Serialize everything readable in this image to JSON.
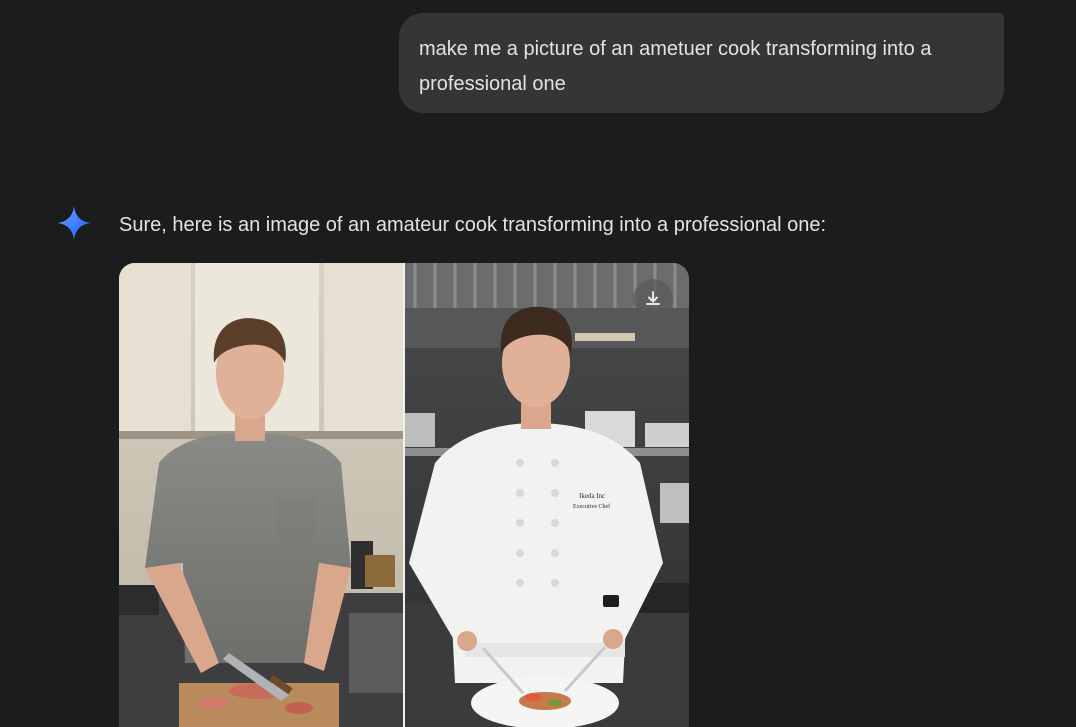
{
  "conversation": {
    "user_prompt": "make me a picture of an ametuer cook transforming into a professional one",
    "assistant_reply": "Sure, here is an image of an amateur cook transforming into a professional one:"
  },
  "generated_image": {
    "panels": [
      {
        "subject": "amateur cook in grey t-shirt slicing meat in home kitchen"
      },
      {
        "subject": "professional chef in white chef jacket plating a dish in restaurant kitchen"
      }
    ],
    "jacket_embroidery": [
      "Ikeda Inc",
      "Executive Chef"
    ]
  },
  "icons": {
    "assistant": "gemini-sparkle-icon",
    "download": "download-icon"
  },
  "colors": {
    "background": "#1b1c1e",
    "user_bubble": "#333537",
    "text": "#e3e3e3",
    "sparkle_start": "#4e8cff",
    "sparkle_end": "#1a5cff"
  }
}
